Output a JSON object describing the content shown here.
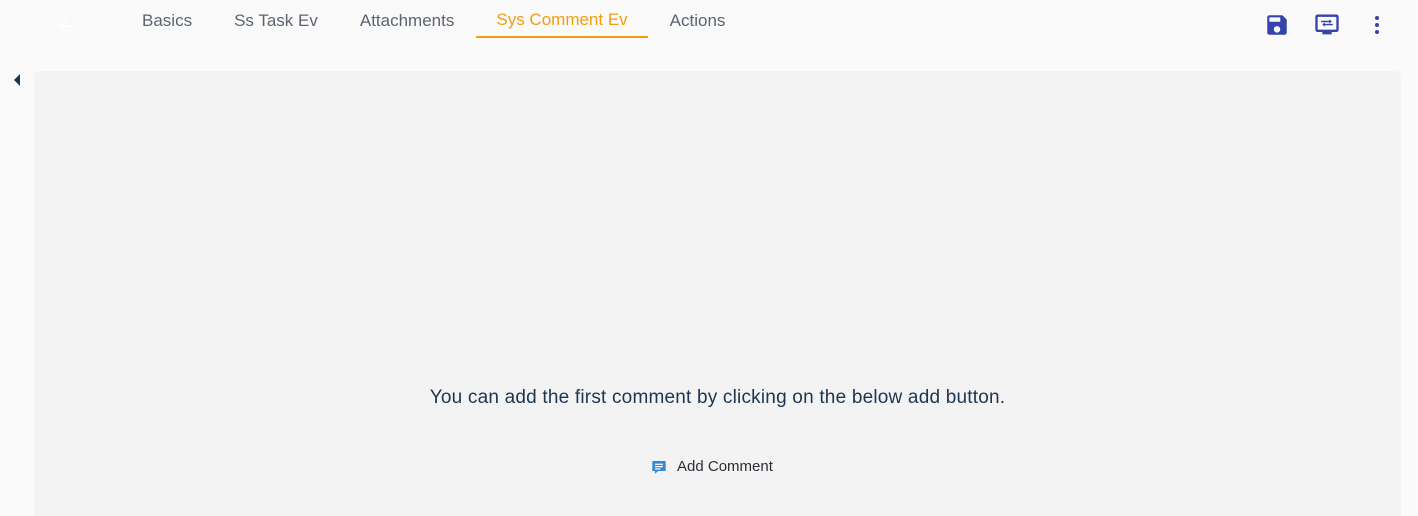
{
  "colors": {
    "accent": "#f39c12",
    "primary_icon": "#3444a8",
    "comment_icon": "#2e8bd8",
    "message_text": "#1c3550"
  },
  "header": {
    "back_icon": "arrow-left-icon",
    "tabs": [
      {
        "label": "Basics",
        "active": false
      },
      {
        "label": "Ss Task Ev",
        "active": false
      },
      {
        "label": "Attachments",
        "active": false
      },
      {
        "label": "Sys Comment Ev",
        "active": true
      },
      {
        "label": "Actions",
        "active": false
      }
    ],
    "actions": [
      {
        "icon": "save-icon"
      },
      {
        "icon": "transfer-icon"
      },
      {
        "icon": "more-vert-icon"
      }
    ]
  },
  "sidebar": {
    "toggle_icon": "caret-left-icon"
  },
  "main": {
    "empty_message": "You can add the first comment by clicking on the below add button.",
    "add_comment_label": "Add Comment",
    "add_comment_icon": "comment-icon"
  }
}
